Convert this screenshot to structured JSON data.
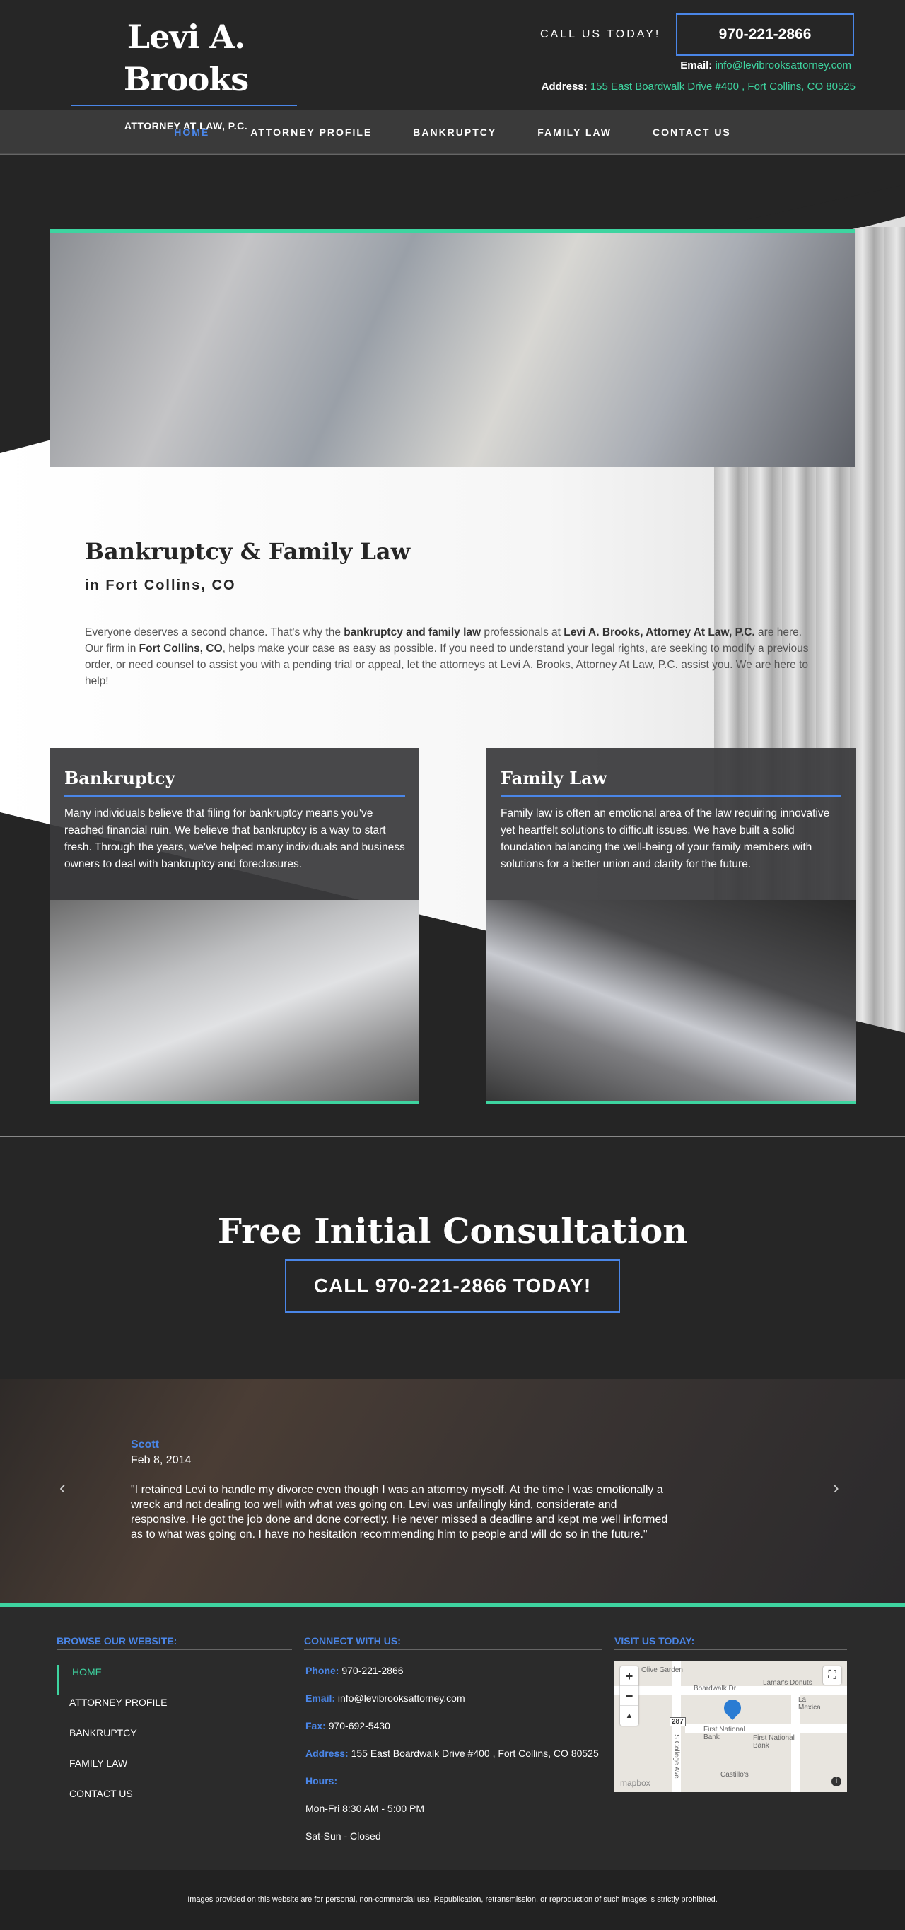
{
  "header": {
    "logo_name": "Levi A. Brooks",
    "logo_sub": "ATTORNEY AT LAW, P.C.",
    "call_us": "CALL US TODAY!",
    "phone": "970-221-2866",
    "email_label": "Email:",
    "email": "info@levibrooksattorney.com",
    "address_label": "Address:",
    "address": "155 East Boardwalk Drive #400 , Fort Collins, CO 80525"
  },
  "nav": {
    "items": [
      "HOME",
      "ATTORNEY PROFILE",
      "BANKRUPTCY",
      "FAMILY LAW",
      "CONTACT US"
    ],
    "active": "HOME"
  },
  "hero": {
    "title": "Bankruptcy & Family Law",
    "subtitle": "in Fort Collins, CO",
    "text_1": "Everyone deserves a second chance. That's why the ",
    "text_b1": "bankruptcy and family law",
    "text_2": " professionals at ",
    "text_b2": "Levi A. Brooks, Attorney At Law, P.C.",
    "text_3": " are here. Our firm in ",
    "text_b3": "Fort Collins, CO",
    "text_4": ", helps make your case as easy as possible. If you need to understand your legal rights, are seeking to modify a previous order, or need counsel to assist you with a pending trial or appeal, let the attorneys at Levi A. Brooks, Attorney At Law, P.C. assist you. We are here to help!"
  },
  "cards": [
    {
      "title": "Bankruptcy",
      "text": "Many individuals believe that filing for bankruptcy means you've reached financial ruin. We believe that bankruptcy is a way to start fresh. Through the years, we've helped many individuals and business owners to deal with bankruptcy and foreclosures."
    },
    {
      "title": "Family Law",
      "text": "Family law is often an emotional area of the law requiring innovative yet heartfelt solutions to difficult issues. We have built a solid foundation balancing the well-being of your family members with solutions for a better union and clarity for the future."
    }
  ],
  "consultation": {
    "title": "Free Initial Consultation",
    "button": "CALL 970-221-2866 TODAY!"
  },
  "testimonial": {
    "name": "Scott",
    "date": "Feb 8, 2014",
    "quote": "\"I retained Levi to handle my divorce even though I was an attorney myself. At the time I was emotionally a wreck and not dealing too well with what was going on. Levi was unfailingly kind, considerate and responsive. He got the job done and done correctly. He never missed a deadline and kept me well informed as to what was going on. I have no hesitation recommending him to people and will do so in the future.\"",
    "prev": "‹",
    "next": "›"
  },
  "footer": {
    "browse_heading": "BROWSE OUR WEBSITE:",
    "connect_heading": "CONNECT WITH US:",
    "visit_heading": "VISIT US TODAY:",
    "links": [
      "HOME",
      "ATTORNEY PROFILE",
      "BANKRUPTCY",
      "FAMILY LAW",
      "CONTACT US"
    ],
    "phone_label": "Phone:",
    "phone": "970-221-2866",
    "email_label": "Email:",
    "email": "info@levibrooksattorney.com",
    "fax_label": "Fax:",
    "fax": "970-692-5430",
    "address_label": "Address:",
    "address": "155 East Boardwalk Drive #400 , Fort Collins, CO 80525",
    "hours_label": "Hours:",
    "hours_1": "Mon-Fri 8:30 AM - 5:00 PM",
    "hours_2": "Sat-Sun - Closed",
    "map": {
      "zoom_in": "+",
      "zoom_out": "−",
      "reset": "▲",
      "fullscreen": "⛶",
      "labels": [
        "Olive Garden",
        "Boardwalk Dr",
        "Lamar's Donuts",
        "First National Bank",
        "First National Bank",
        "Castillo's",
        "La Mexica",
        "S College Ave",
        "287"
      ],
      "logo": "mapbox",
      "info": "i"
    }
  },
  "disclaimer": "Images provided on this website are for personal, non-commercial use. Republication, retransmission, or reproduction of such images is strictly prohibited."
}
